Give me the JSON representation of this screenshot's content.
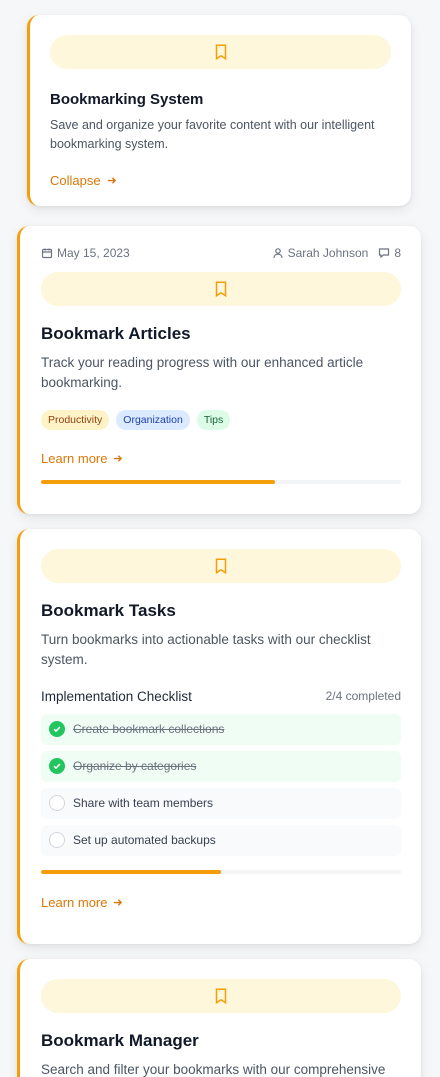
{
  "cards": [
    {
      "title": "Bookmarking System",
      "description": "Save and organize your favorite content with our intelligent bookmarking system.",
      "link": "Collapse"
    },
    {
      "date": "May 15, 2023",
      "author": "Sarah Johnson",
      "comments": "8",
      "title": "Bookmark Articles",
      "description": "Track your reading progress with our enhanced article bookmarking.",
      "tags": [
        {
          "label": "Productivity",
          "bg": "#fef3c7",
          "color": "#92400e"
        },
        {
          "label": "Organization",
          "bg": "#dbeafe",
          "color": "#1e40af"
        },
        {
          "label": "Tips",
          "bg": "#dcfce7",
          "color": "#166534"
        }
      ],
      "link": "Learn more",
      "progress": 0.65
    },
    {
      "title": "Bookmark Tasks",
      "description": "Turn bookmarks into actionable tasks with our checklist system.",
      "checklist_title": "Implementation Checklist",
      "checklist_status": "2/4 completed",
      "checklist": [
        {
          "label": "Create bookmark collections",
          "done": true
        },
        {
          "label": "Organize by categories",
          "done": true
        },
        {
          "label": "Share with team members",
          "done": false
        },
        {
          "label": "Set up automated backups",
          "done": false
        }
      ],
      "progress": 0.5,
      "link": "Learn more"
    },
    {
      "title": "Bookmark Manager",
      "description": "Search and filter your bookmarks with our comprehensive"
    }
  ],
  "colors": {
    "accent": "#f59e0b",
    "link": "#d97706",
    "pill": "#fef7dc"
  },
  "icons": [
    "bookmark-icon",
    "calendar-icon",
    "user-icon",
    "comment-icon",
    "arrow-right-icon",
    "check-icon"
  ]
}
